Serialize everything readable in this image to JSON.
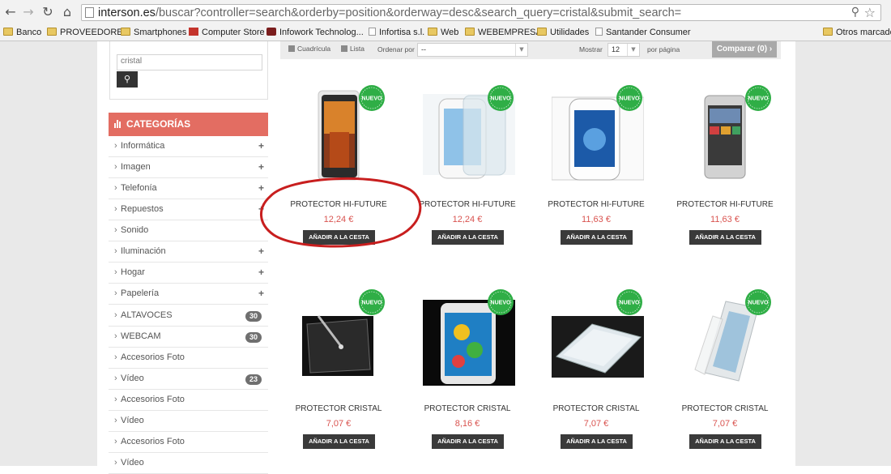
{
  "browser": {
    "url_domain": "interson.es",
    "url_path": "/buscar?controller=search&orderby=position&orderway=desc&search_query=cristal&submit_search=",
    "bookmarks": [
      {
        "label": "Banco",
        "icon": "folder-icon"
      },
      {
        "label": "PROVEEDORES",
        "icon": "folder-icon"
      },
      {
        "label": "Smartphones",
        "icon": "folder-icon"
      },
      {
        "label": "Computer Store",
        "icon": "computer-store-icon"
      },
      {
        "label": "Infowork Technolog...",
        "icon": "infowork-icon"
      },
      {
        "label": "Infortisa s.l.",
        "icon": "page-icon"
      },
      {
        "label": "Web",
        "icon": "folder-icon"
      },
      {
        "label": "WEBEMPRESA",
        "icon": "folder-icon"
      },
      {
        "label": "Utilidades",
        "icon": "folder-icon"
      },
      {
        "label": "Santander Consumer",
        "icon": "page-icon"
      }
    ],
    "other_bookmarks": "Otros marcador"
  },
  "search": {
    "value": "cristal"
  },
  "categories": {
    "title": "CATEGORÍAS",
    "items": [
      {
        "label": "Informática",
        "plus": "+"
      },
      {
        "label": "Imagen",
        "plus": "+"
      },
      {
        "label": "Telefonía",
        "plus": "+"
      },
      {
        "label": "Repuestos",
        "plus": "+"
      },
      {
        "label": "Sonido"
      },
      {
        "label": "Iluminación",
        "plus": "+"
      },
      {
        "label": "Hogar",
        "plus": "+"
      },
      {
        "label": "Papelería",
        "plus": "+"
      },
      {
        "label": "ALTAVOCES",
        "count": "30"
      },
      {
        "label": "WEBCAM",
        "count": "30"
      },
      {
        "label": "Accesorios Foto"
      },
      {
        "label": "Vídeo",
        "count": "23"
      },
      {
        "label": "Accesorios Foto"
      },
      {
        "label": "Vídeo"
      },
      {
        "label": "Accesorios Foto"
      },
      {
        "label": "Vídeo"
      }
    ]
  },
  "toolbar": {
    "view_grid": "Cuadrícula",
    "view_list": "Lista",
    "sort_label": "Ordenar por",
    "sort_value": "--",
    "show_label": "Mostrar",
    "show_value": "12",
    "per_page": "por página",
    "compare": "Comparar (0)",
    "compare_arrow": "›"
  },
  "products": [
    {
      "name": "PROTECTOR HI-FUTURE",
      "price": "12,24 €",
      "badge": "NUEVO",
      "cart": "AÑADIR A LA CESTA"
    },
    {
      "name": "PROTECTOR HI-FUTURE",
      "price": "12,24 €",
      "badge": "NUEVO",
      "cart": "AÑADIR A LA CESTA"
    },
    {
      "name": "PROTECTOR HI-FUTURE",
      "price": "11,63 €",
      "badge": "NUEVO",
      "cart": "AÑADIR A LA CESTA"
    },
    {
      "name": "PROTECTOR HI-FUTURE",
      "price": "11,63 €",
      "badge": "NUEVO",
      "cart": "AÑADIR A LA CESTA"
    },
    {
      "name": "PROTECTOR CRISTAL",
      "price": "7,07 €",
      "badge": "NUEVO",
      "cart": "AÑADIR A LA CESTA"
    },
    {
      "name": "PROTECTOR CRISTAL",
      "price": "8,16 €",
      "badge": "NUEVO",
      "cart": "AÑADIR A LA CESTA"
    },
    {
      "name": "PROTECTOR CRISTAL",
      "price": "7,07 €",
      "badge": "NUEVO",
      "cart": "AÑADIR A LA CESTA"
    },
    {
      "name": "PROTECTOR CRISTAL",
      "price": "7,07 €",
      "badge": "NUEVO",
      "cart": "AÑADIR A LA CESTA"
    }
  ],
  "colors": {
    "category_header": "#e36d62",
    "badge_green": "#2fae46",
    "price_red": "#d9534f",
    "annotation_red": "#c81e1e",
    "compare_button": "#a9a9a9"
  }
}
